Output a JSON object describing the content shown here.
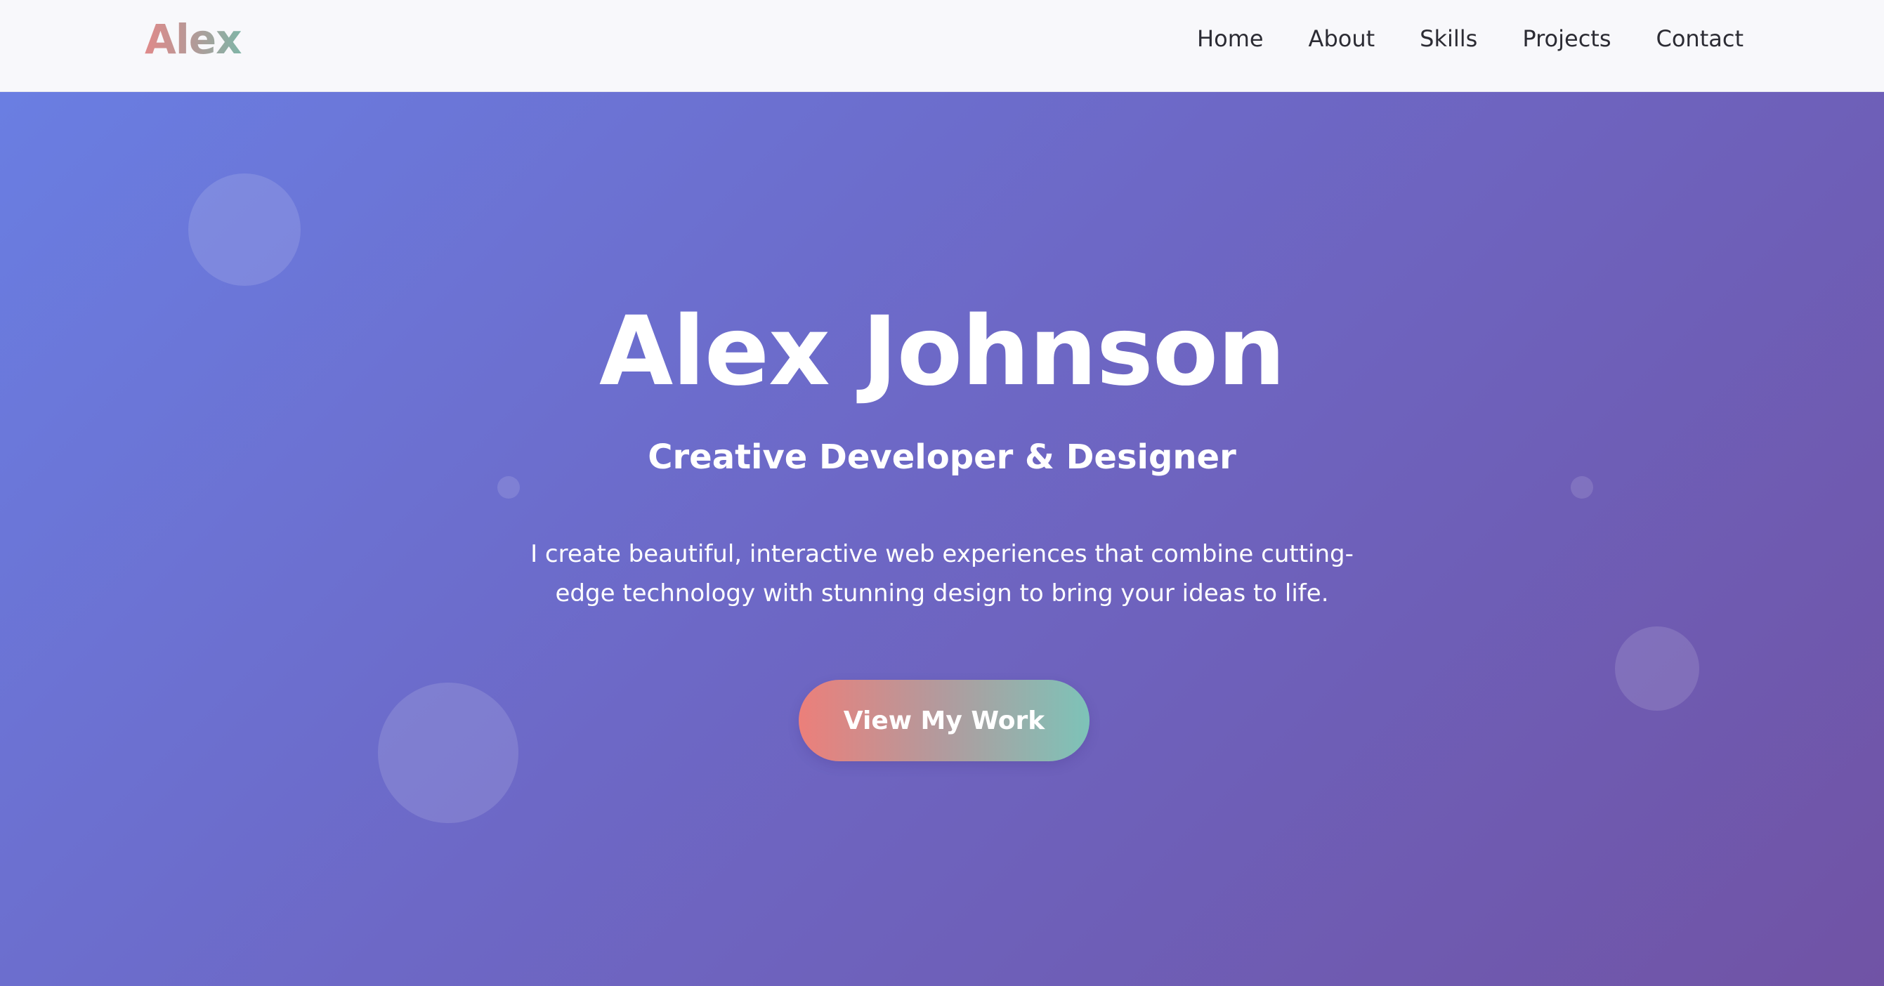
{
  "header": {
    "logo": "Alex",
    "nav": [
      "Home",
      "About",
      "Skills",
      "Projects",
      "Contact"
    ]
  },
  "hero": {
    "title": "Alex Johnson",
    "subtitle": "Creative Developer & Designer",
    "description": "I create beautiful, interactive web experiences that combine cutting-edge technology with stunning design to bring your ideas to life.",
    "cta_label": "View My Work"
  },
  "colors": {
    "hero_gradient_start": "#6a7ee2",
    "hero_gradient_end": "#7053a5",
    "cta_gradient_start": "#ec7f7a",
    "cta_gradient_end": "#7dc3b8",
    "navbar_bg": "#f8f8fb",
    "nav_text": "#2c2c34"
  }
}
